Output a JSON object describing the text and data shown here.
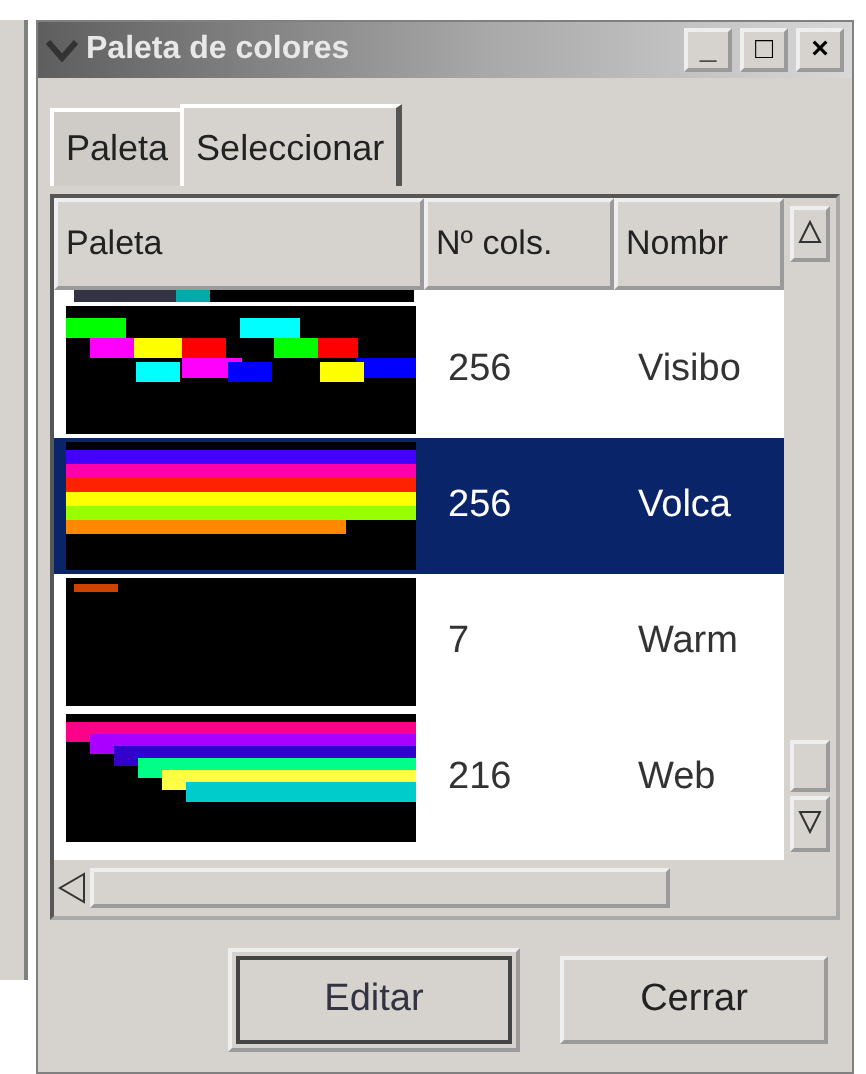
{
  "window": {
    "title": "Paleta de colores",
    "controls": [
      "_",
      "□",
      "×"
    ]
  },
  "tabs": [
    {
      "label": "Paleta",
      "selected": false
    },
    {
      "label": "Seleccionar",
      "selected": true
    }
  ],
  "table": {
    "columns": [
      "Paleta",
      "Nº cols.",
      "Nombr"
    ],
    "rows": [
      {
        "count": "256",
        "name": "Visibo",
        "selected": false
      },
      {
        "count": "256",
        "name": "Volca",
        "selected": true
      },
      {
        "count": "7",
        "name": "Warm",
        "selected": false
      },
      {
        "count": "216",
        "name": "Web",
        "selected": false
      }
    ]
  },
  "buttons": [
    {
      "label": "Editar",
      "default": true
    },
    {
      "label": "Cerrar",
      "default": false
    }
  ]
}
